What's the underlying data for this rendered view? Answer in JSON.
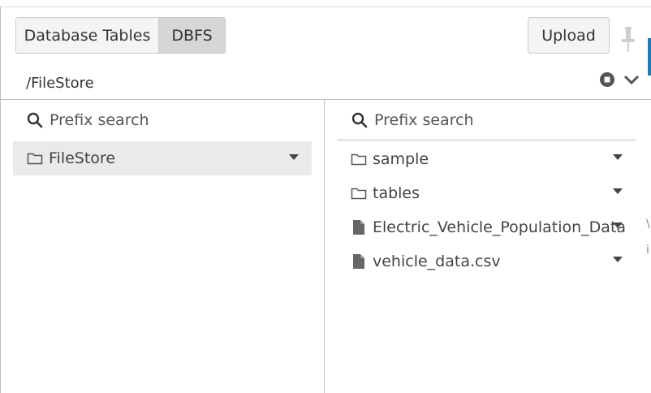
{
  "tabs": {
    "database_tables": "Database Tables",
    "dbfs": "DBFS"
  },
  "upload_label": "Upload",
  "path": "/FileStore",
  "left_pane": {
    "search_placeholder": "Prefix search",
    "items": [
      {
        "label": "FileStore",
        "type": "folder"
      }
    ]
  },
  "right_pane": {
    "search_placeholder": "Prefix search",
    "items": [
      {
        "label": "sample",
        "type": "folder"
      },
      {
        "label": "tables",
        "type": "folder"
      },
      {
        "label": "Electric_Vehicle_Population_Data.csv",
        "type": "file"
      },
      {
        "label": "vehicle_data.csv",
        "type": "file"
      }
    ]
  },
  "icons": {
    "search": "search-icon",
    "folder": "folder-icon",
    "file": "file-icon",
    "pin": "pin-icon",
    "stop": "stop-icon",
    "expand": "chevron-down-icon",
    "menu": "caret-down-icon"
  },
  "colors": {
    "accent": "#1f7bb0",
    "selected_bg": "#eaeaea",
    "active_tab": "#d6d6d6"
  }
}
